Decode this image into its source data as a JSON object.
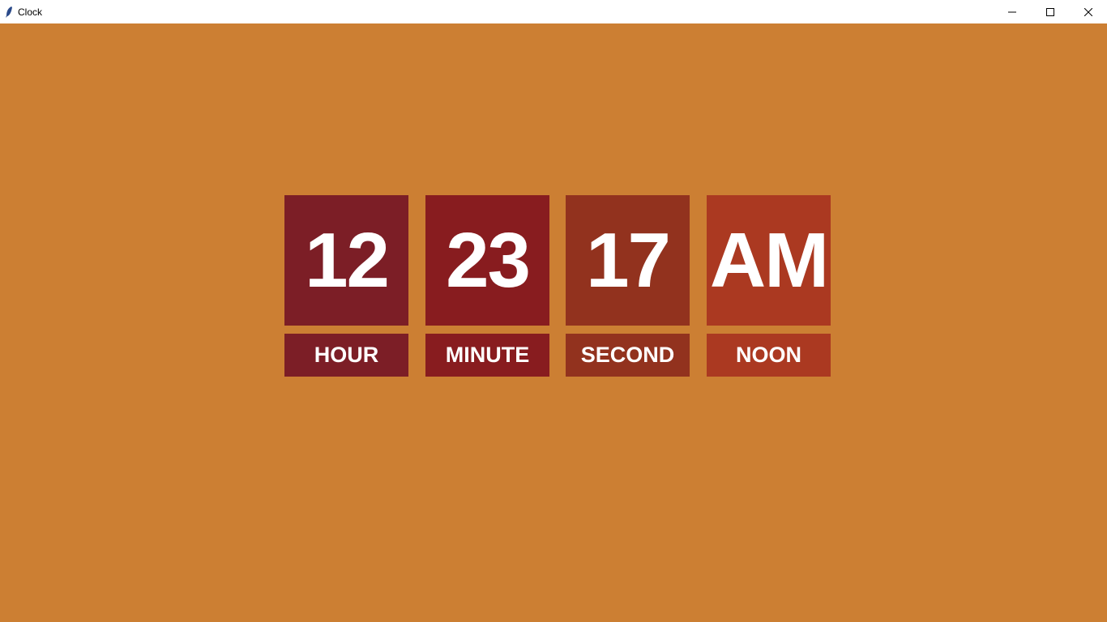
{
  "window": {
    "title": "Clock",
    "background": "#cc7f33",
    "icon": "feather-icon",
    "controls": [
      "minimize-icon",
      "maximize-icon",
      "close-icon"
    ]
  },
  "clock": {
    "hour": {
      "value": "12",
      "label": "HOUR",
      "color": "#7c1e26"
    },
    "minute": {
      "value": "23",
      "label": "MINUTE",
      "color": "#881c1f"
    },
    "second": {
      "value": "17",
      "label": "SECOND",
      "color": "#92321e"
    },
    "noon": {
      "value": "AM",
      "label": "NOON",
      "color": "#ab3921"
    }
  }
}
